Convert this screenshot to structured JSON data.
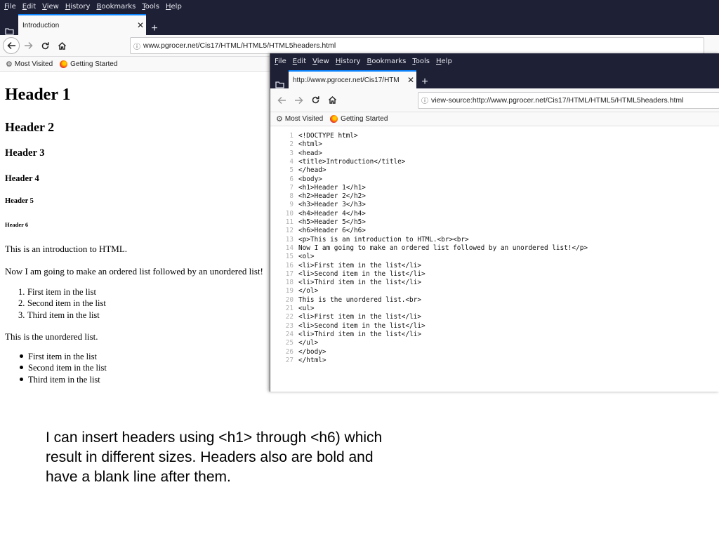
{
  "menu": [
    "File",
    "Edit",
    "View",
    "History",
    "Bookmarks",
    "Tools",
    "Help"
  ],
  "browser1": {
    "tab_title": "Introduction",
    "url": "www.pgrocer.net/Cis17/HTML/HTML5/HTML5headers.html",
    "bookmarks": [
      "Most Visited",
      "Getting Started"
    ]
  },
  "browser2": {
    "tab_title": "http://www.pgrocer.net/Cis17/HTM",
    "url": "view-source:http://www.pgrocer.net/Cis17/HTML/HTML5/HTML5headers.html",
    "bookmarks": [
      "Most Visited",
      "Getting Started"
    ]
  },
  "rendered": {
    "h1": "Header 1",
    "h2": "Header 2",
    "h3": "Header 3",
    "h4": "Header 4",
    "h5": "Header 5",
    "h6": "Header 6",
    "para1": "This is an introduction to HTML.",
    "para2": "Now I am going to make an ordered list followed by an unordered list!",
    "ordered": [
      "First item in the list",
      "Second item in the list",
      "Third item in the list"
    ],
    "unordered_intro": "This is the unordered list.",
    "unordered": [
      "First item in the list",
      "Second item in the list",
      "Third item in the list"
    ]
  },
  "source_lines": [
    "<!DOCTYPE html>",
    "<html>",
    "<head>",
    "<title>Introduction</title>",
    "</head>",
    "<body>",
    "<h1>Header 1</h1>",
    "<h2>Header 2</h2>",
    "<h3>Header 3</h3>",
    "<h4>Header 4</h4>",
    "<h5>Header 5</h5>",
    "<h6>Header 6</h6>",
    "<p>This is an introduction to HTML.<br><br>",
    "Now I am going to make an ordered list followed by an unordered list!</p>",
    "<ol>",
    "<li>First item in the list</li>",
    "<li>Second item in the list</li>",
    "<li>Third item in the list</li>",
    "</ol>",
    "This is the unordered list.<br>",
    "<ul>",
    "<li>First item in the list</li>",
    "<li>Second item in the list</li>",
    "<li>Third item in the list</li>",
    "</ul>",
    "</body>",
    "</html>"
  ],
  "caption": [
    "I can insert headers using <h1> through <h6) which",
    "result in different sizes.  Headers also are bold and",
    "have a blank line after them."
  ]
}
